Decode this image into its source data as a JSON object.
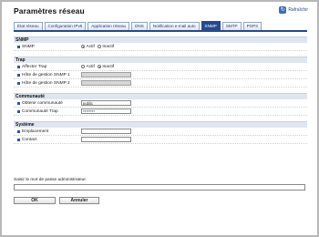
{
  "header": {
    "title": "Paramètres réseau",
    "refresh_label": "Rafraîchir"
  },
  "tabs": [
    {
      "label": "État réseau"
    },
    {
      "label": "Configuration IPv6"
    },
    {
      "label": "Application réseau"
    },
    {
      "label": "DNS"
    },
    {
      "label": "Notification e-mail auto"
    },
    {
      "label": "SNMP",
      "active": true
    },
    {
      "label": "SMTP"
    },
    {
      "label": "POP3"
    }
  ],
  "snmp": {
    "section": "SNMP",
    "label": "SNMP",
    "option_active": "Actif",
    "option_inactive": "Inactif",
    "selected": "Actif"
  },
  "trap": {
    "section": "Trap",
    "affecter_label": "Affecter Trap",
    "option_active": "Actif",
    "option_inactive": "Inactif",
    "selected": "Inactif",
    "host1_label": "Hôte de gestion SNMP 1",
    "host1_value": "",
    "host2_label": "Hôte de gestion SNMP 2",
    "host2_value": ""
  },
  "community": {
    "section": "Communauté",
    "get_label": "Obtenir communauté",
    "get_value": "public",
    "trap_label": "Communauté Trap",
    "trap_value": "********"
  },
  "system": {
    "section": "Système",
    "location_label": "Emplacement",
    "location_value": "",
    "contact_label": "Contact",
    "contact_value": ""
  },
  "admin": {
    "prompt": "Saisir le mot de passe administrateur.",
    "value": ""
  },
  "buttons": {
    "ok": "OK",
    "cancel": "Annuler"
  },
  "colors": {
    "accent": "#234b8f",
    "section_bg": "#dfe6f0"
  }
}
